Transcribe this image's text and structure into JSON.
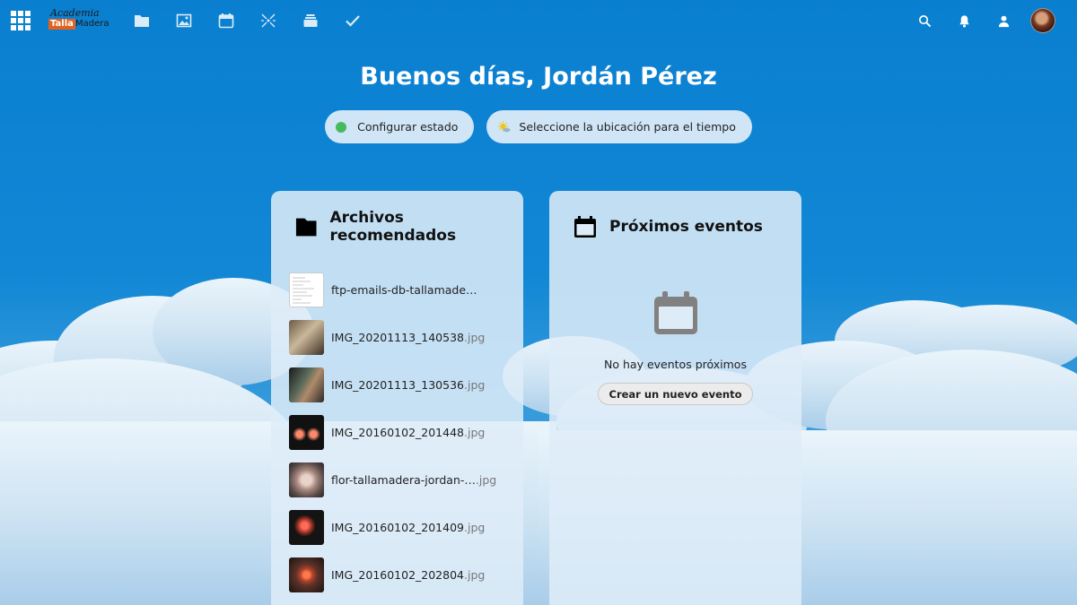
{
  "brand": {
    "line1": "Academia",
    "line2a": "Talla",
    "line2b": "Madera"
  },
  "nav": {
    "items": [
      {
        "icon": "files-icon"
      },
      {
        "icon": "photos-icon"
      },
      {
        "icon": "calendar-icon"
      },
      {
        "icon": "activity-icon"
      },
      {
        "icon": "deck-icon"
      },
      {
        "icon": "tasks-icon"
      }
    ],
    "right": [
      "search-icon",
      "notifications-icon",
      "contacts-icon",
      "avatar"
    ]
  },
  "greeting": "Buenos días, Jordán Pérez",
  "status": {
    "set_status_label": "Configurar estado",
    "weather_label": "Seleccione la ubicación para el tiempo",
    "status_color": "#46ba61"
  },
  "files_panel": {
    "title": "Archivos recomendados",
    "files": [
      {
        "name": "ftp-emails-db-tallamade…",
        "ext": ""
      },
      {
        "name": "IMG_20201113_140538",
        "ext": ".jpg"
      },
      {
        "name": "IMG_20201113_130536",
        "ext": ".jpg"
      },
      {
        "name": "IMG_20160102_201448",
        "ext": ".jpg"
      },
      {
        "name": "flor-tallamadera-jordan-…",
        "ext": " .jpg"
      },
      {
        "name": "IMG_20160102_201409",
        "ext": ".jpg"
      },
      {
        "name": "IMG_20160102_202804",
        "ext": ".jpg"
      }
    ]
  },
  "events_panel": {
    "title": "Próximos eventos",
    "empty_text": "No hay eventos próximos",
    "create_button": "Crear un nuevo evento"
  },
  "colors": {
    "accent": "#0f82d1",
    "panel": "#deecf8"
  }
}
